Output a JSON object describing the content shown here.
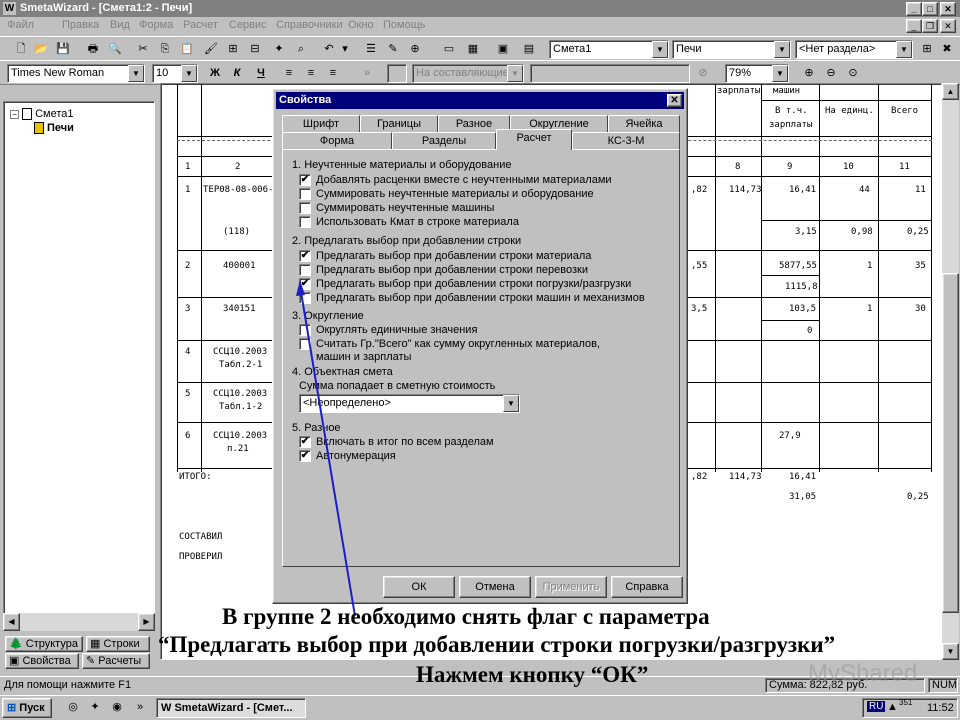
{
  "window": {
    "title": "SmetaWizard - [Смета1:2 - Печи]",
    "app_icon": "W"
  },
  "menu": [
    "Файл",
    "Правка",
    "Вид",
    "Форма",
    "Расчет",
    "Сервис",
    "Справочники",
    "Окно",
    "Помощь"
  ],
  "toolbar": {
    "doc_combo": "Смета1",
    "section_combo": "Печи",
    "chapter_combo": "<Нет раздела>",
    "font_combo": "Times New Roman",
    "size_combo": "10",
    "bold": "Ж",
    "italic": "К",
    "underline": "Ч",
    "composition_combo": "На составляющие",
    "zoom_combo": "79%"
  },
  "tree": {
    "root": "Смета1",
    "child": "Печи"
  },
  "left_tabs": {
    "structure": "Структура",
    "lines": "Строки",
    "properties": "Свойства",
    "calculations": "Расчеты"
  },
  "doc": {
    "h_salary": "зарплаты",
    "h_machines": "машин",
    "h_incl": "В т.ч.",
    "h_incl2": "зарплаты",
    "h_per_unit": "На единц.",
    "h_total": "Всего",
    "col_nums": [
      "1",
      "2",
      "8",
      "9",
      "10",
      "11"
    ],
    "rows": [
      {
        "n": "1",
        "code": "ТЕР08-08-006-3",
        "sub": "(118)",
        "c8a": ",82",
        "c8b": "114,73",
        "c9": "16,41",
        "c9b": "3,15",
        "c10": "44",
        "c10b": "0,98",
        "c11": "11",
        "c11b": "0,25"
      },
      {
        "n": "2",
        "code": "400001",
        "c8a": ",55",
        "c9": "5877,55",
        "c9b": "1115,8",
        "c10": "1",
        "c11": "35"
      },
      {
        "n": "3",
        "code": "340151",
        "c8a": "3,5",
        "c9": "103,5",
        "c9b": "0",
        "c10": "1",
        "c11": "30"
      },
      {
        "n": "4",
        "code": "ССЦ10.2003",
        "sub": "Табл.2-1"
      },
      {
        "n": "5",
        "code": "ССЦ10.2003",
        "sub": "Табл.1-2"
      },
      {
        "n": "6",
        "code": "ССЦ10.2003",
        "sub": "п.21",
        "c9": "27,9"
      }
    ],
    "total_label": "ИТОГО:",
    "total_c8a": ",82",
    "total_c8b": "114,73",
    "total_c9": "16,41",
    "total_c9b": "31,05",
    "total_c11b": "0,25",
    "compiled": "СОСТАВИЛ",
    "checked": "ПРОВЕРИЛ"
  },
  "dialog": {
    "title": "Свойства",
    "tabs_row1": [
      "Шрифт",
      "Границы",
      "Разное",
      "Округление",
      "Ячейка"
    ],
    "tabs_row2": [
      "Форма",
      "Разделы",
      "Расчет",
      "КС-3-М"
    ],
    "active_tab": "Расчет",
    "group1": {
      "title": "1. Неучтенные материалы и оборудование",
      "items": [
        {
          "label": "Добавлять расценки вместе с неучтенными материалами",
          "checked": true
        },
        {
          "label": "Суммировать неучтенные материалы и оборудование",
          "checked": false
        },
        {
          "label": "Суммировать неучтенные машины",
          "checked": false
        },
        {
          "label": "Использовать Кмат в строке материала",
          "checked": false
        }
      ]
    },
    "group2": {
      "title": "2. Предлагать выбор при добавлении строки",
      "items": [
        {
          "label": "Предлагать выбор при добавлении строки материала",
          "checked": true
        },
        {
          "label": "Предлагать выбор при добавлении строки перевозки",
          "checked": false
        },
        {
          "label": "Предлагать выбор при добавлении строки погрузки/разгрузки",
          "checked": true
        },
        {
          "label": "Предлагать выбор при добавлении строки машин и механизмов",
          "checked": false
        }
      ]
    },
    "group3": {
      "title": "3. Округление",
      "items": [
        {
          "label": "Округлять единичные значения",
          "checked": false
        },
        {
          "label": "Считать Гр.\"Всего\" как сумму округленных материалов,",
          "label2": "машин и зарплаты",
          "checked": false
        }
      ]
    },
    "group4": {
      "title": "4. Объектная смета",
      "sublabel": "Сумма попадает в сметную стоимость",
      "select": "<Неопределено>"
    },
    "group5": {
      "title": "5. Разное",
      "items": [
        {
          "label": "Включать в итог по всем разделам",
          "checked": true
        },
        {
          "label": "Автонумерация",
          "checked": true
        }
      ]
    },
    "buttons": {
      "ok": "ОК",
      "cancel": "Отмена",
      "apply": "Применить",
      "help": "Справка"
    }
  },
  "status": {
    "hint": "Для помощи нажмите F1",
    "sum": "Сумма: 822,82 руб.",
    "num": "NUM"
  },
  "taskbar": {
    "start": "Пуск",
    "task": "SmetaWizard - [Смет...",
    "lang": "RU",
    "clock": "11:52",
    "tray_num": "351"
  },
  "caption": {
    "line1": "В группе 2 необходимо снять флаг с параметра",
    "line2": "“Предлагать выбор при добавлении строки погрузки/разгрузки”",
    "line3": "Нажмем кнопку “ОК”"
  },
  "watermark": "MyShared",
  "colors": {
    "title_active": "#00007b",
    "title_inactive": "#808080",
    "face": "#c0c0c0",
    "arrow": "#1c1cc8"
  }
}
